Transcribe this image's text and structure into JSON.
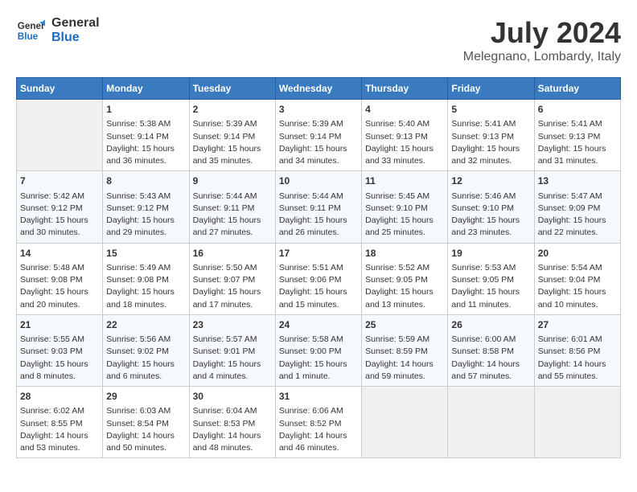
{
  "header": {
    "logo_general": "General",
    "logo_blue": "Blue",
    "month": "July 2024",
    "location": "Melegnano, Lombardy, Italy"
  },
  "days_of_week": [
    "Sunday",
    "Monday",
    "Tuesday",
    "Wednesday",
    "Thursday",
    "Friday",
    "Saturday"
  ],
  "weeks": [
    [
      {
        "day": "",
        "content": ""
      },
      {
        "day": "1",
        "content": "Sunrise: 5:38 AM\nSunset: 9:14 PM\nDaylight: 15 hours\nand 36 minutes."
      },
      {
        "day": "2",
        "content": "Sunrise: 5:39 AM\nSunset: 9:14 PM\nDaylight: 15 hours\nand 35 minutes."
      },
      {
        "day": "3",
        "content": "Sunrise: 5:39 AM\nSunset: 9:14 PM\nDaylight: 15 hours\nand 34 minutes."
      },
      {
        "day": "4",
        "content": "Sunrise: 5:40 AM\nSunset: 9:13 PM\nDaylight: 15 hours\nand 33 minutes."
      },
      {
        "day": "5",
        "content": "Sunrise: 5:41 AM\nSunset: 9:13 PM\nDaylight: 15 hours\nand 32 minutes."
      },
      {
        "day": "6",
        "content": "Sunrise: 5:41 AM\nSunset: 9:13 PM\nDaylight: 15 hours\nand 31 minutes."
      }
    ],
    [
      {
        "day": "7",
        "content": "Sunrise: 5:42 AM\nSunset: 9:12 PM\nDaylight: 15 hours\nand 30 minutes."
      },
      {
        "day": "8",
        "content": "Sunrise: 5:43 AM\nSunset: 9:12 PM\nDaylight: 15 hours\nand 29 minutes."
      },
      {
        "day": "9",
        "content": "Sunrise: 5:44 AM\nSunset: 9:11 PM\nDaylight: 15 hours\nand 27 minutes."
      },
      {
        "day": "10",
        "content": "Sunrise: 5:44 AM\nSunset: 9:11 PM\nDaylight: 15 hours\nand 26 minutes."
      },
      {
        "day": "11",
        "content": "Sunrise: 5:45 AM\nSunset: 9:10 PM\nDaylight: 15 hours\nand 25 minutes."
      },
      {
        "day": "12",
        "content": "Sunrise: 5:46 AM\nSunset: 9:10 PM\nDaylight: 15 hours\nand 23 minutes."
      },
      {
        "day": "13",
        "content": "Sunrise: 5:47 AM\nSunset: 9:09 PM\nDaylight: 15 hours\nand 22 minutes."
      }
    ],
    [
      {
        "day": "14",
        "content": "Sunrise: 5:48 AM\nSunset: 9:08 PM\nDaylight: 15 hours\nand 20 minutes."
      },
      {
        "day": "15",
        "content": "Sunrise: 5:49 AM\nSunset: 9:08 PM\nDaylight: 15 hours\nand 18 minutes."
      },
      {
        "day": "16",
        "content": "Sunrise: 5:50 AM\nSunset: 9:07 PM\nDaylight: 15 hours\nand 17 minutes."
      },
      {
        "day": "17",
        "content": "Sunrise: 5:51 AM\nSunset: 9:06 PM\nDaylight: 15 hours\nand 15 minutes."
      },
      {
        "day": "18",
        "content": "Sunrise: 5:52 AM\nSunset: 9:05 PM\nDaylight: 15 hours\nand 13 minutes."
      },
      {
        "day": "19",
        "content": "Sunrise: 5:53 AM\nSunset: 9:05 PM\nDaylight: 15 hours\nand 11 minutes."
      },
      {
        "day": "20",
        "content": "Sunrise: 5:54 AM\nSunset: 9:04 PM\nDaylight: 15 hours\nand 10 minutes."
      }
    ],
    [
      {
        "day": "21",
        "content": "Sunrise: 5:55 AM\nSunset: 9:03 PM\nDaylight: 15 hours\nand 8 minutes."
      },
      {
        "day": "22",
        "content": "Sunrise: 5:56 AM\nSunset: 9:02 PM\nDaylight: 15 hours\nand 6 minutes."
      },
      {
        "day": "23",
        "content": "Sunrise: 5:57 AM\nSunset: 9:01 PM\nDaylight: 15 hours\nand 4 minutes."
      },
      {
        "day": "24",
        "content": "Sunrise: 5:58 AM\nSunset: 9:00 PM\nDaylight: 15 hours\nand 1 minute."
      },
      {
        "day": "25",
        "content": "Sunrise: 5:59 AM\nSunset: 8:59 PM\nDaylight: 14 hours\nand 59 minutes."
      },
      {
        "day": "26",
        "content": "Sunrise: 6:00 AM\nSunset: 8:58 PM\nDaylight: 14 hours\nand 57 minutes."
      },
      {
        "day": "27",
        "content": "Sunrise: 6:01 AM\nSunset: 8:56 PM\nDaylight: 14 hours\nand 55 minutes."
      }
    ],
    [
      {
        "day": "28",
        "content": "Sunrise: 6:02 AM\nSunset: 8:55 PM\nDaylight: 14 hours\nand 53 minutes."
      },
      {
        "day": "29",
        "content": "Sunrise: 6:03 AM\nSunset: 8:54 PM\nDaylight: 14 hours\nand 50 minutes."
      },
      {
        "day": "30",
        "content": "Sunrise: 6:04 AM\nSunset: 8:53 PM\nDaylight: 14 hours\nand 48 minutes."
      },
      {
        "day": "31",
        "content": "Sunrise: 6:06 AM\nSunset: 8:52 PM\nDaylight: 14 hours\nand 46 minutes."
      },
      {
        "day": "",
        "content": ""
      },
      {
        "day": "",
        "content": ""
      },
      {
        "day": "",
        "content": ""
      }
    ]
  ]
}
